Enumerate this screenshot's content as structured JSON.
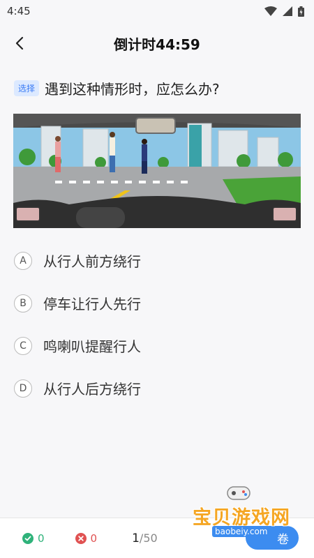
{
  "status_bar": {
    "time": "4:45"
  },
  "header": {
    "title": "倒计时44:59"
  },
  "question": {
    "tag": "选择",
    "text": "遇到这种情形时，应怎么办?"
  },
  "options": [
    {
      "letter": "A",
      "text": "从行人前方绕行"
    },
    {
      "letter": "B",
      "text": "停车让行人先行"
    },
    {
      "letter": "C",
      "text": "鸣喇叭提醒行人"
    },
    {
      "letter": "D",
      "text": "从行人后方绕行"
    }
  ],
  "footer": {
    "correct_count": "0",
    "wrong_count": "0",
    "current": "1",
    "total": "/50",
    "submit_label": "卷"
  },
  "watermark": {
    "brand": "宝贝游戏网",
    "url": "baobeiy.com"
  },
  "colors": {
    "accent": "#3c8cf0",
    "correct": "#2fb27a",
    "wrong": "#e05252",
    "tag_bg": "#dce9ff"
  }
}
